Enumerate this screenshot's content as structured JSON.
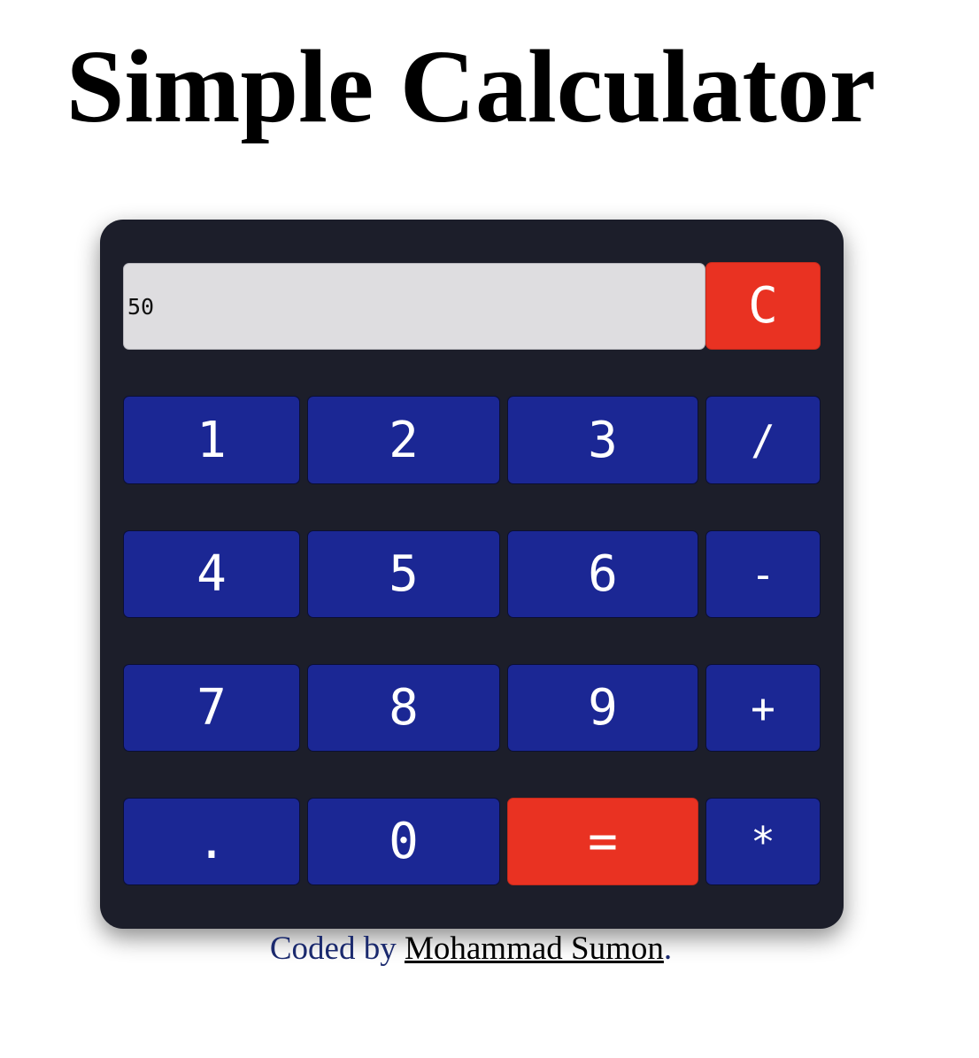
{
  "page": {
    "title": "Simple Calculator"
  },
  "calculator": {
    "display_value": "50",
    "clear_label": "C",
    "rows": [
      [
        "1",
        "2",
        "3",
        "/"
      ],
      [
        "4",
        "5",
        "6",
        "-"
      ],
      [
        "7",
        "8",
        "9",
        "+"
      ],
      [
        ".",
        "0",
        "=",
        "*"
      ]
    ]
  },
  "footer": {
    "prefix": "Coded by ",
    "author": "Mohammad Sumon",
    "suffix": "."
  },
  "colors": {
    "calculator_body": "#1c1e2a",
    "key_blue": "#1b2794",
    "key_red": "#e93222",
    "display_bg": "#dedde0",
    "footer_text": "#1b2a6e"
  }
}
